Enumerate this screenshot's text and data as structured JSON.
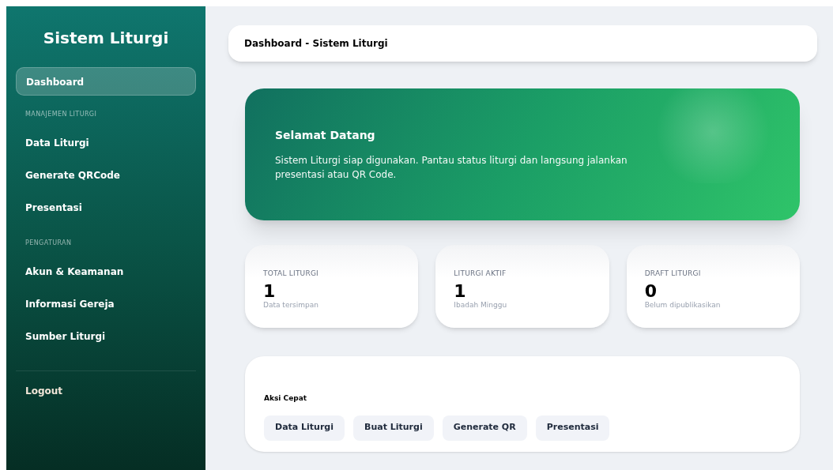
{
  "sidebar": {
    "title": "Sistem Liturgi",
    "sections": [
      {
        "items": [
          {
            "label": "Dashboard",
            "selected": true
          }
        ]
      },
      {
        "heading": "MANAJEMEN LITURGI",
        "items": [
          {
            "label": "Data Liturgi",
            "selected": false
          },
          {
            "label": "Generate QRCode",
            "selected": false
          },
          {
            "label": "Presentasi",
            "selected": false
          }
        ]
      },
      {
        "heading": "PENGATURAN",
        "items": [
          {
            "label": "Akun & Keamanan",
            "selected": false
          },
          {
            "label": "Informasi Gereja",
            "selected": false
          },
          {
            "label": "Sumber Liturgi",
            "selected": false
          }
        ]
      }
    ],
    "logout": "Logout"
  },
  "header": {
    "title": "Dashboard - Sistem Liturgi"
  },
  "banner": {
    "title": "Selamat Datang",
    "text": "Sistem Liturgi siap digunakan. Pantau status liturgi dan langsung jalankan presentasi atau QR Code."
  },
  "stats": [
    {
      "label": "TOTAL LITURGI",
      "value": "1",
      "note": "Data tersimpan"
    },
    {
      "label": "LITURGI AKTIF",
      "value": "1",
      "note": "Ibadah Minggu"
    },
    {
      "label": "DRAFT LITURGI",
      "value": "0",
      "note": "Belum dipublikasikan"
    }
  ],
  "quick_actions": {
    "title": "Aksi Cepat",
    "buttons": [
      "Data Liturgi",
      "Buat Liturgi",
      "Generate QR",
      "Presentasi"
    ]
  }
}
